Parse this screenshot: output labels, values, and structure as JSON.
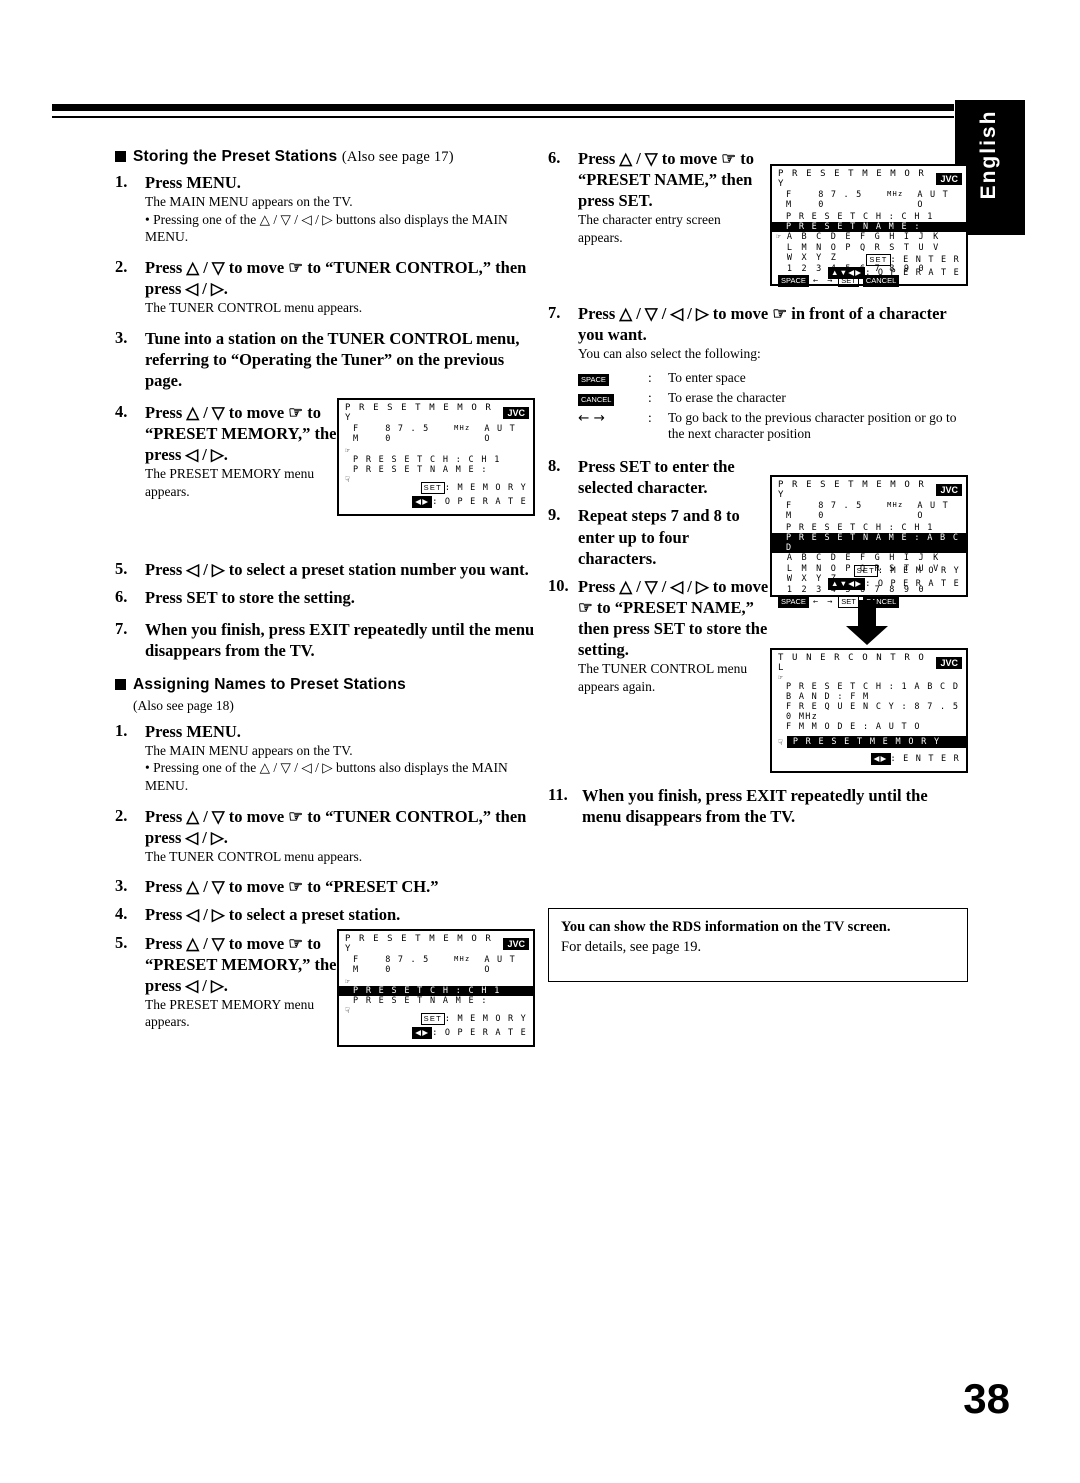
{
  "language_tab": "English",
  "page_number": "38",
  "left_column": {
    "section1": {
      "heading": "Storing the Preset Stations",
      "also_see": "(Also see page 17)",
      "steps": [
        {
          "num": "1.",
          "text": "Press MENU.",
          "notes": [
            "The MAIN MENU appears on the TV.",
            "• Pressing one of the △ / ▽ / ◁ / ▷ buttons also displays the MAIN MENU."
          ]
        },
        {
          "num": "2.",
          "text": "Press △ / ▽ to move ☞ to “TUNER CONTROL,” then press ◁ / ▷.",
          "notes": [
            "The TUNER CONTROL menu appears."
          ]
        },
        {
          "num": "3.",
          "text": "Tune into a station on the TUNER CONTROL menu, referring to “Operating the Tuner” on the previous page.",
          "notes": []
        },
        {
          "num": "4.",
          "text": "Press △ / ▽ to move ☞ to “PRESET MEMORY,” then press ◁ / ▷.",
          "notes": [
            "The PRESET MEMORY menu appears."
          ]
        },
        {
          "num": "5.",
          "text": "Press ◁ / ▷ to select a preset station number you want.",
          "notes": []
        },
        {
          "num": "6.",
          "text": "Press SET to store the setting.",
          "notes": []
        },
        {
          "num": "7.",
          "text": "When you finish, press EXIT repeatedly until the menu disappears from the TV.",
          "notes": []
        }
      ]
    },
    "section2": {
      "heading": "Assigning Names to Preset Stations",
      "also_see": "(Also see page 18)",
      "steps": [
        {
          "num": "1.",
          "text": "Press MENU.",
          "notes": [
            "The MAIN MENU appears on the TV.",
            "• Pressing one of the △ / ▽ / ◁ / ▷ buttons also displays the MAIN MENU."
          ]
        },
        {
          "num": "2.",
          "text": "Press △ / ▽ to move ☞ to “TUNER CONTROL,” then press ◁ / ▷.",
          "notes": [
            "The TUNER CONTROL menu appears."
          ]
        },
        {
          "num": "3.",
          "text": "Press △ / ▽ to move ☞ to “PRESET CH.”",
          "notes": []
        },
        {
          "num": "4.",
          "text": "Press ◁ / ▷ to select a preset station.",
          "notes": []
        },
        {
          "num": "5.",
          "text": "Press △ / ▽ to move ☞ to “PRESET MEMORY,” then press ◁ / ▷.",
          "notes": [
            "The PRESET MEMORY menu appears."
          ]
        }
      ]
    }
  },
  "right_column": {
    "steps": [
      {
        "num": "6.",
        "text": "Press △ / ▽ to move ☞ to “PRESET NAME,” then press SET.",
        "notes": [
          "The character entry screen appears."
        ]
      },
      {
        "num": "7.",
        "text": "Press △ / ▽ / ◁ / ▷ to move ☞ in front of a character you want.",
        "notes": [
          "You can also select the following:"
        ]
      },
      {
        "num": "8.",
        "text": "Press SET to enter the selected character.",
        "notes": []
      },
      {
        "num": "9.",
        "text": "Repeat steps 7 and 8 to enter up to four characters.",
        "notes": []
      },
      {
        "num": "10.",
        "text": "Press △ / ▽ / ◁ / ▷ to move ☞ to “PRESET NAME,” then press SET to store the setting.",
        "notes": [
          "The TUNER CONTROL menu appears again."
        ]
      },
      {
        "num": "11.",
        "text": "When you finish, press EXIT repeatedly until the menu disappears from the TV.",
        "notes": []
      }
    ],
    "symbol_list": [
      {
        "key": "SPACE",
        "sep": ":",
        "desc": "To enter space"
      },
      {
        "key": "CANCEL",
        "sep": ":",
        "desc": "To erase the character"
      },
      {
        "key": "← →",
        "sep": ":",
        "desc": "To go back to the previous character position or go to the next character position"
      }
    ]
  },
  "rds_note": {
    "line1": "You can show the RDS information on the TV screen.",
    "line2": "For details, see page 19."
  },
  "osd_screens": {
    "preset_memory_1": {
      "title": "P R E S E T   M E M O R Y",
      "brand": "JVC",
      "band": "F M",
      "freq": "8 7 . 5 0",
      "freq_unit": "MHz",
      "mode": "A U T O",
      "row_ch_label": "P R E S E T   C H",
      "row_ch_sep": ":",
      "row_ch_value": "C H   1",
      "row_name_label": "P R E S E T   N A M E :",
      "foot1_key": "SET",
      "foot1_label": ": M E M O R Y",
      "foot2_key": "◀▶",
      "foot2_label": ": O P E R A T E"
    },
    "preset_memory_2": {
      "title": "P R E S E T   M E M O R Y",
      "brand": "JVC",
      "band": "F M",
      "freq": "8 7 . 5 0",
      "freq_unit": "MHz",
      "mode": "A U T O",
      "row_ch_label": "P R E S E T   C H",
      "row_ch_sep": ":",
      "row_ch_value": "C H   1",
      "row_name_label": "P R E S E T   N A M E :",
      "foot1_key": "SET",
      "foot1_label": ": M E M O R Y",
      "foot2_key": "◀▶",
      "foot2_label": ": O P E R A T E"
    },
    "char_entry_1": {
      "title": "P R E S E T   M E M O R Y",
      "brand": "JVC",
      "band": "F M",
      "freq": "8 7 . 5 0",
      "freq_unit": "MHz",
      "mode": "A U T O",
      "row_ch_label": "P R E S E T   C H",
      "row_ch_sep": ":",
      "row_ch_value": "C H   1",
      "row_name_label": "P R E S E T   N A M E :",
      "grid": [
        "A  B  C  D  E  F  G  H  I  J  K",
        "L  M  N  O  P  Q  R  S  T  U  V",
        "W  X  Y  Z",
        "1  2  3  4  5  6  7  8  9  0"
      ],
      "key_space": "SPACE",
      "key_cancel": "CANCEL",
      "arrows": "←  →",
      "foot1_key": "SET",
      "foot1_label": ": E N T E R",
      "foot2_key": "▲▼◀▶",
      "foot2_label": ": O P E R A T E"
    },
    "char_entry_2": {
      "title": "P R E S E T   M E M O R Y",
      "brand": "JVC",
      "band": "F M",
      "freq": "8 7 . 5 0",
      "freq_unit": "MHz",
      "mode": "A U T O",
      "row_ch_label": "P R E S E T   C H",
      "row_ch_sep": ":",
      "row_ch_value": "C H   1",
      "row_name_label": "P R E S E T   N A M E :",
      "row_name_value": "A B C D",
      "grid": [
        "A  B  C  D  E  F  G  H  I  J  K",
        "L  M  N  O  P  Q  R  S  T  U  V",
        "W  X  Y  Z",
        "1  2  3  4  5  6  7  8  9  0"
      ],
      "key_space": "SPACE",
      "key_cancel": "CANCEL",
      "arrows": "←  →",
      "foot1_key": "SET",
      "foot1_label": ": M E M O R Y",
      "foot2_key": "▲▼◀▶",
      "foot2_label": ": O P E R A T E"
    },
    "tuner_control": {
      "title": "T U N E R   C O N T R O L",
      "brand": "JVC",
      "rows": [
        {
          "label": "P R E S E T   C H",
          "sep": ":",
          "value": "1   A B C D"
        },
        {
          "label": "B A N D",
          "sep": ":",
          "value": "F M"
        },
        {
          "label": "F R E Q U E N C Y",
          "sep": ":",
          "value": "8 7 . 5 0 MHz"
        },
        {
          "label": "F M   M O D E",
          "sep": ":",
          "value": "A U T O"
        }
      ],
      "highlight_row": "P R E S E T   M E M O R Y",
      "foot_key": "◀▶",
      "foot_label": ": E N T E R"
    }
  }
}
